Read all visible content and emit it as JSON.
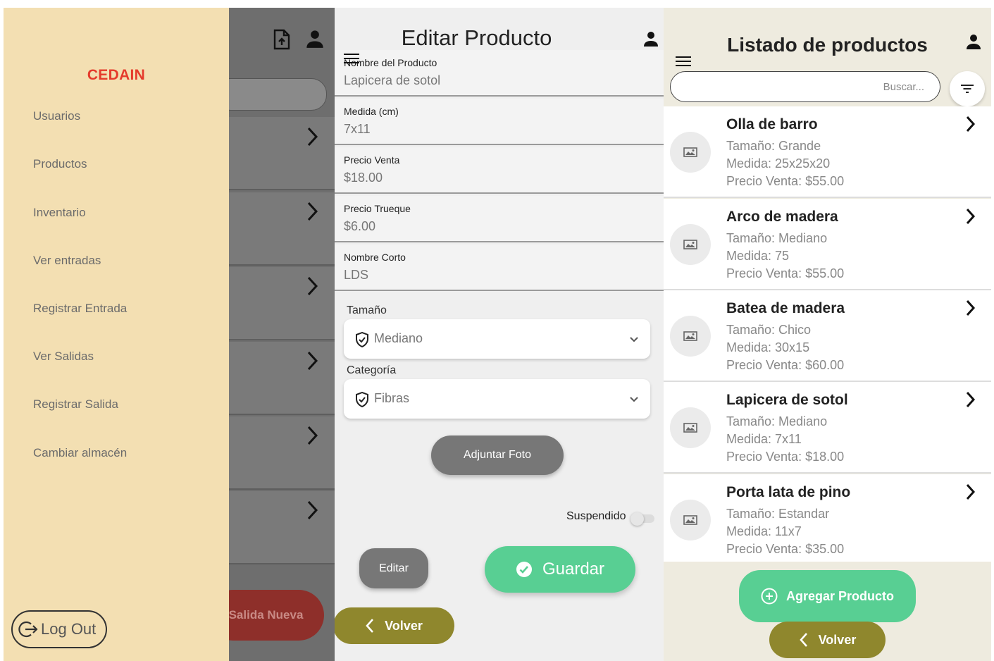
{
  "drawer": {
    "title": "CEDAIN",
    "items": [
      "Usuarios",
      "Productos",
      "Inventario",
      "Ver entradas",
      "Registrar Entrada",
      "Ver Salidas",
      "Registrar Salida",
      "Cambiar almacén"
    ],
    "logout_label": "Log Out",
    "behind_fab_label": "Salida Nueva"
  },
  "edit": {
    "title": "Editar Producto",
    "fields": [
      {
        "label": "Nombre del Producto",
        "value": "Lapicera de sotol"
      },
      {
        "label": "Medida (cm)",
        "value": "7x11"
      },
      {
        "label": "Precio Venta",
        "value": "$18.00"
      },
      {
        "label": "Precio Trueque",
        "value": "$6.00"
      },
      {
        "label": "Nombre Corto",
        "value": "LDS"
      }
    ],
    "tamano_label": "Tamaño",
    "tamano_value": "Mediano",
    "categoria_label": "Categoría",
    "categoria_value": "Fibras",
    "adjuntar_label": "Adjuntar Foto",
    "suspendido_label": "Suspendido",
    "suspendido_on": false,
    "editar_label": "Editar",
    "guardar_label": "Guardar",
    "volver_label": "Volver"
  },
  "listado": {
    "title": "Listado de productos",
    "search_placeholder": "Buscar...",
    "products": [
      {
        "name": "Olla de barro",
        "tamano": "Tamaño: Grande",
        "medida": "Medida: 25x25x20",
        "precio": "Precio Venta: $55.00"
      },
      {
        "name": "Arco de madera",
        "tamano": "Tamaño: Mediano",
        "medida": "Medida: 75",
        "precio": "Precio Venta: $55.00"
      },
      {
        "name": "Batea de madera",
        "tamano": "Tamaño: Chico",
        "medida": "Medida: 30x15",
        "precio": "Precio Venta: $60.00"
      },
      {
        "name": "Lapicera de sotol",
        "tamano": "Tamaño: Mediano",
        "medida": "Medida: 7x11",
        "precio": "Precio Venta: $18.00"
      },
      {
        "name": "Porta lata de pino",
        "tamano": "Tamaño: Estandar",
        "medida": "Medida: 11x7",
        "precio": "Precio Venta: $35.00"
      }
    ],
    "agregar_label": "Agregar Producto",
    "volver_label": "Volver"
  },
  "colors": {
    "drawer_bg": "#f3dfb2",
    "brand_red": "#e53b2c",
    "green": "#58cf93",
    "olive": "#8f872d"
  }
}
